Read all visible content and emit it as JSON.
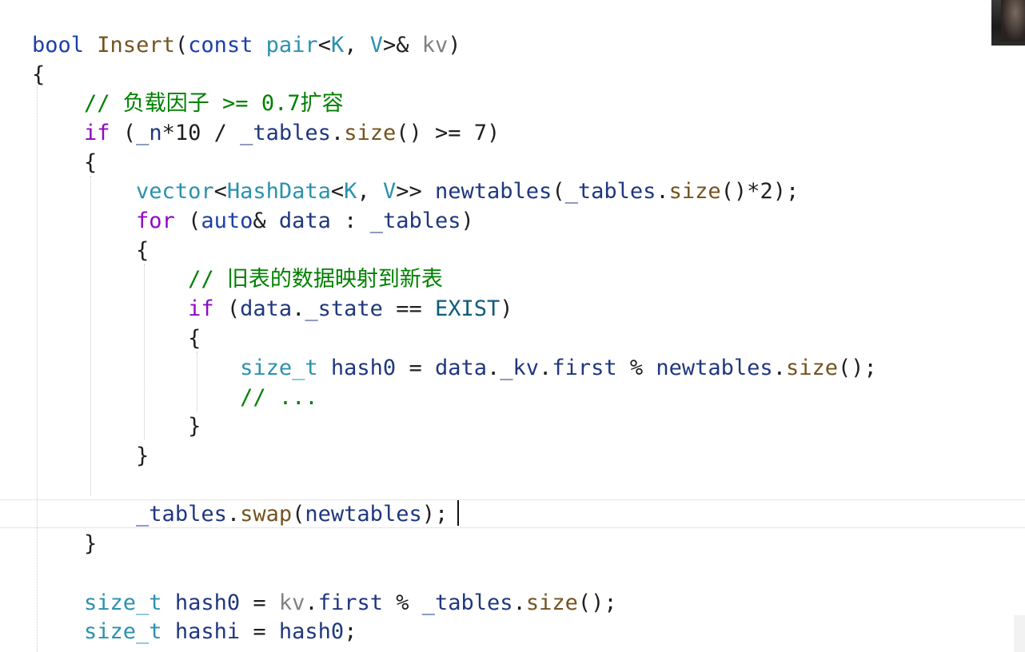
{
  "window": {
    "content": "C++ code editor"
  },
  "code": {
    "lines": [
      [
        {
          "t": "bool",
          "c": "kw"
        },
        {
          "t": " ",
          "c": "plain"
        },
        {
          "t": "Insert",
          "c": "fn"
        },
        {
          "t": "(",
          "c": "plain"
        },
        {
          "t": "const",
          "c": "kw"
        },
        {
          "t": " ",
          "c": "plain"
        },
        {
          "t": "pair",
          "c": "type"
        },
        {
          "t": "<",
          "c": "plain"
        },
        {
          "t": "K",
          "c": "type"
        },
        {
          "t": ", ",
          "c": "plain"
        },
        {
          "t": "V",
          "c": "type"
        },
        {
          "t": ">& ",
          "c": "plain"
        },
        {
          "t": "kv",
          "c": "param"
        },
        {
          "t": ")",
          "c": "plain"
        }
      ],
      [
        {
          "t": "{",
          "c": "plain"
        }
      ],
      [
        {
          "t": "    ",
          "c": "plain"
        },
        {
          "t": "// 负载因子 >= 0.7扩容",
          "c": "comment"
        }
      ],
      [
        {
          "t": "    ",
          "c": "plain"
        },
        {
          "t": "if",
          "c": "ctrl"
        },
        {
          "t": " (",
          "c": "plain"
        },
        {
          "t": "_n",
          "c": "var"
        },
        {
          "t": "*10 / ",
          "c": "plain"
        },
        {
          "t": "_tables",
          "c": "var"
        },
        {
          "t": ".",
          "c": "plain"
        },
        {
          "t": "size",
          "c": "fn"
        },
        {
          "t": "() >= 7)",
          "c": "plain"
        }
      ],
      [
        {
          "t": "    {",
          "c": "plain"
        }
      ],
      [
        {
          "t": "        ",
          "c": "plain"
        },
        {
          "t": "vector",
          "c": "type"
        },
        {
          "t": "<",
          "c": "plain"
        },
        {
          "t": "HashData",
          "c": "type"
        },
        {
          "t": "<",
          "c": "plain"
        },
        {
          "t": "K",
          "c": "type"
        },
        {
          "t": ", ",
          "c": "plain"
        },
        {
          "t": "V",
          "c": "type"
        },
        {
          "t": ">> ",
          "c": "plain"
        },
        {
          "t": "newtables",
          "c": "var"
        },
        {
          "t": "(",
          "c": "plain"
        },
        {
          "t": "_tables",
          "c": "var"
        },
        {
          "t": ".",
          "c": "plain"
        },
        {
          "t": "size",
          "c": "fn"
        },
        {
          "t": "()*2);",
          "c": "plain"
        }
      ],
      [
        {
          "t": "        ",
          "c": "plain"
        },
        {
          "t": "for",
          "c": "ctrl"
        },
        {
          "t": " (",
          "c": "plain"
        },
        {
          "t": "auto",
          "c": "kw"
        },
        {
          "t": "& ",
          "c": "plain"
        },
        {
          "t": "data",
          "c": "var"
        },
        {
          "t": " : ",
          "c": "plain"
        },
        {
          "t": "_tables",
          "c": "var"
        },
        {
          "t": ")",
          "c": "plain"
        }
      ],
      [
        {
          "t": "        {",
          "c": "plain"
        }
      ],
      [
        {
          "t": "            ",
          "c": "plain"
        },
        {
          "t": "// 旧表的数据映射到新表",
          "c": "comment"
        }
      ],
      [
        {
          "t": "            ",
          "c": "plain"
        },
        {
          "t": "if",
          "c": "ctrl"
        },
        {
          "t": " (",
          "c": "plain"
        },
        {
          "t": "data",
          "c": "var"
        },
        {
          "t": ".",
          "c": "plain"
        },
        {
          "t": "_state",
          "c": "var"
        },
        {
          "t": " == ",
          "c": "plain"
        },
        {
          "t": "EXIST",
          "c": "macro"
        },
        {
          "t": ")",
          "c": "plain"
        }
      ],
      [
        {
          "t": "            {",
          "c": "plain"
        }
      ],
      [
        {
          "t": "                ",
          "c": "plain"
        },
        {
          "t": "size_t",
          "c": "type"
        },
        {
          "t": " ",
          "c": "plain"
        },
        {
          "t": "hash0",
          "c": "var"
        },
        {
          "t": " = ",
          "c": "plain"
        },
        {
          "t": "data",
          "c": "var"
        },
        {
          "t": ".",
          "c": "plain"
        },
        {
          "t": "_kv",
          "c": "var"
        },
        {
          "t": ".",
          "c": "plain"
        },
        {
          "t": "first",
          "c": "var"
        },
        {
          "t": " % ",
          "c": "plain"
        },
        {
          "t": "newtables",
          "c": "var"
        },
        {
          "t": ".",
          "c": "plain"
        },
        {
          "t": "size",
          "c": "fn"
        },
        {
          "t": "();",
          "c": "plain"
        }
      ],
      [
        {
          "t": "                ",
          "c": "plain"
        },
        {
          "t": "// ...",
          "c": "comment"
        }
      ],
      [
        {
          "t": "            }",
          "c": "plain"
        }
      ],
      [
        {
          "t": "        }",
          "c": "plain"
        }
      ],
      [
        {
          "t": "",
          "c": "plain"
        }
      ],
      [
        {
          "t": "        ",
          "c": "plain"
        },
        {
          "t": "_tables",
          "c": "var"
        },
        {
          "t": ".",
          "c": "plain"
        },
        {
          "t": "swap",
          "c": "fn"
        },
        {
          "t": "(",
          "c": "plain"
        },
        {
          "t": "newtables",
          "c": "var"
        },
        {
          "t": ");",
          "c": "plain"
        }
      ],
      [
        {
          "t": "    }",
          "c": "plain"
        }
      ],
      [
        {
          "t": "",
          "c": "plain"
        }
      ],
      [
        {
          "t": "    ",
          "c": "plain"
        },
        {
          "t": "size_t",
          "c": "type"
        },
        {
          "t": " ",
          "c": "plain"
        },
        {
          "t": "hash0",
          "c": "var"
        },
        {
          "t": " = ",
          "c": "plain"
        },
        {
          "t": "kv",
          "c": "param"
        },
        {
          "t": ".",
          "c": "plain"
        },
        {
          "t": "first",
          "c": "var"
        },
        {
          "t": " % ",
          "c": "plain"
        },
        {
          "t": "_tables",
          "c": "var"
        },
        {
          "t": ".",
          "c": "plain"
        },
        {
          "t": "size",
          "c": "fn"
        },
        {
          "t": "();",
          "c": "plain"
        }
      ],
      [
        {
          "t": "    ",
          "c": "plain"
        },
        {
          "t": "size_t",
          "c": "type"
        },
        {
          "t": " ",
          "c": "plain"
        },
        {
          "t": "hashi",
          "c": "var"
        },
        {
          "t": " = ",
          "c": "plain"
        },
        {
          "t": "hash0",
          "c": "var"
        },
        {
          "t": ";",
          "c": "plain"
        }
      ]
    ],
    "current_line": 17
  },
  "colors": {
    "keyword": "#1d3fa8",
    "function": "#74531f",
    "type": "#2b91af",
    "parameter": "#808080",
    "variable": "#1f377f",
    "control": "#8f08c4",
    "comment": "#008000",
    "macro": "#0f5b7a",
    "plain": "#1f1f1f",
    "background": "#ffffff"
  }
}
